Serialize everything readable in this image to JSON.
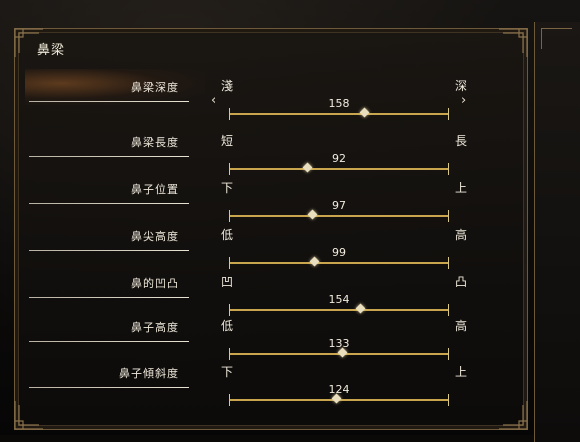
{
  "panel": {
    "title": "鼻梁"
  },
  "sliders": [
    {
      "label": "鼻梁深度",
      "left": "淺",
      "right": "深",
      "value": "158",
      "level": 0.62,
      "selected": true
    },
    {
      "label": "鼻梁長度",
      "left": "短",
      "right": "長",
      "value": "92",
      "level": 0.36,
      "selected": false
    },
    {
      "label": "鼻子位置",
      "left": "下",
      "right": "上",
      "value": "97",
      "level": 0.38,
      "selected": false
    },
    {
      "label": "鼻尖高度",
      "left": "低",
      "right": "高",
      "value": "99",
      "level": 0.39,
      "selected": false
    },
    {
      "label": "鼻的凹凸",
      "left": "凹",
      "right": "凸",
      "value": "154",
      "level": 0.6,
      "selected": false
    },
    {
      "label": "鼻子高度",
      "left": "低",
      "right": "高",
      "value": "133",
      "level": 0.52,
      "selected": false
    },
    {
      "label": "鼻子傾斜度",
      "left": "下",
      "right": "上",
      "value": "124",
      "level": 0.49,
      "selected": false
    }
  ],
  "colors": {
    "track": "#c9a64e",
    "frame": "#6e5a3a",
    "highlight": "#965a28"
  },
  "icons": {
    "arrow_left": "‹",
    "arrow_right": "›"
  }
}
